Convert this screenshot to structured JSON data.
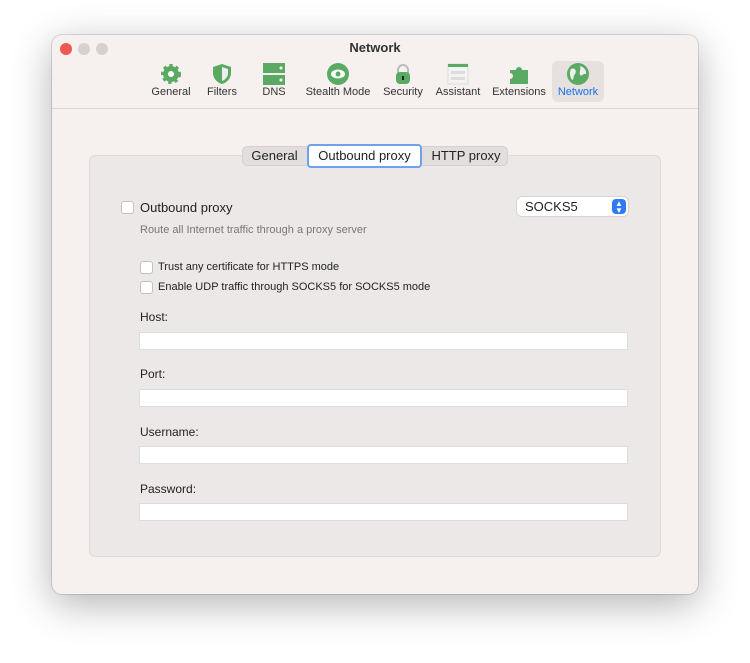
{
  "window": {
    "title": "Network"
  },
  "toolbar": {
    "items": [
      {
        "label": "General",
        "icon": "gear-icon"
      },
      {
        "label": "Filters",
        "icon": "shield-icon"
      },
      {
        "label": "DNS",
        "icon": "server-icon"
      },
      {
        "label": "Stealth Mode",
        "icon": "eye-icon"
      },
      {
        "label": "Security",
        "icon": "lock-icon"
      },
      {
        "label": "Assistant",
        "icon": "browser-window-icon"
      },
      {
        "label": "Extensions",
        "icon": "puzzle-icon"
      },
      {
        "label": "Network",
        "icon": "globe-icon",
        "selected": true
      }
    ]
  },
  "tabs": [
    {
      "label": "General"
    },
    {
      "label": "Outbound proxy",
      "selected": true
    },
    {
      "label": "HTTP proxy"
    }
  ],
  "proxy": {
    "enable_label": "Outbound proxy",
    "enabled": false,
    "description": "Route all Internet traffic through a proxy server",
    "type": "SOCKS5",
    "trust_cert_label": "Trust any certificate for HTTPS mode",
    "udp_label": "Enable UDP traffic through SOCKS5 for SOCKS5 mode",
    "host_label": "Host:",
    "host": "",
    "port_label": "Port:",
    "port": "",
    "username_label": "Username:",
    "username": "",
    "password_label": "Password:",
    "password": ""
  },
  "colors": {
    "accent": "#1a73e8",
    "icon_green": "#5aaa63"
  }
}
